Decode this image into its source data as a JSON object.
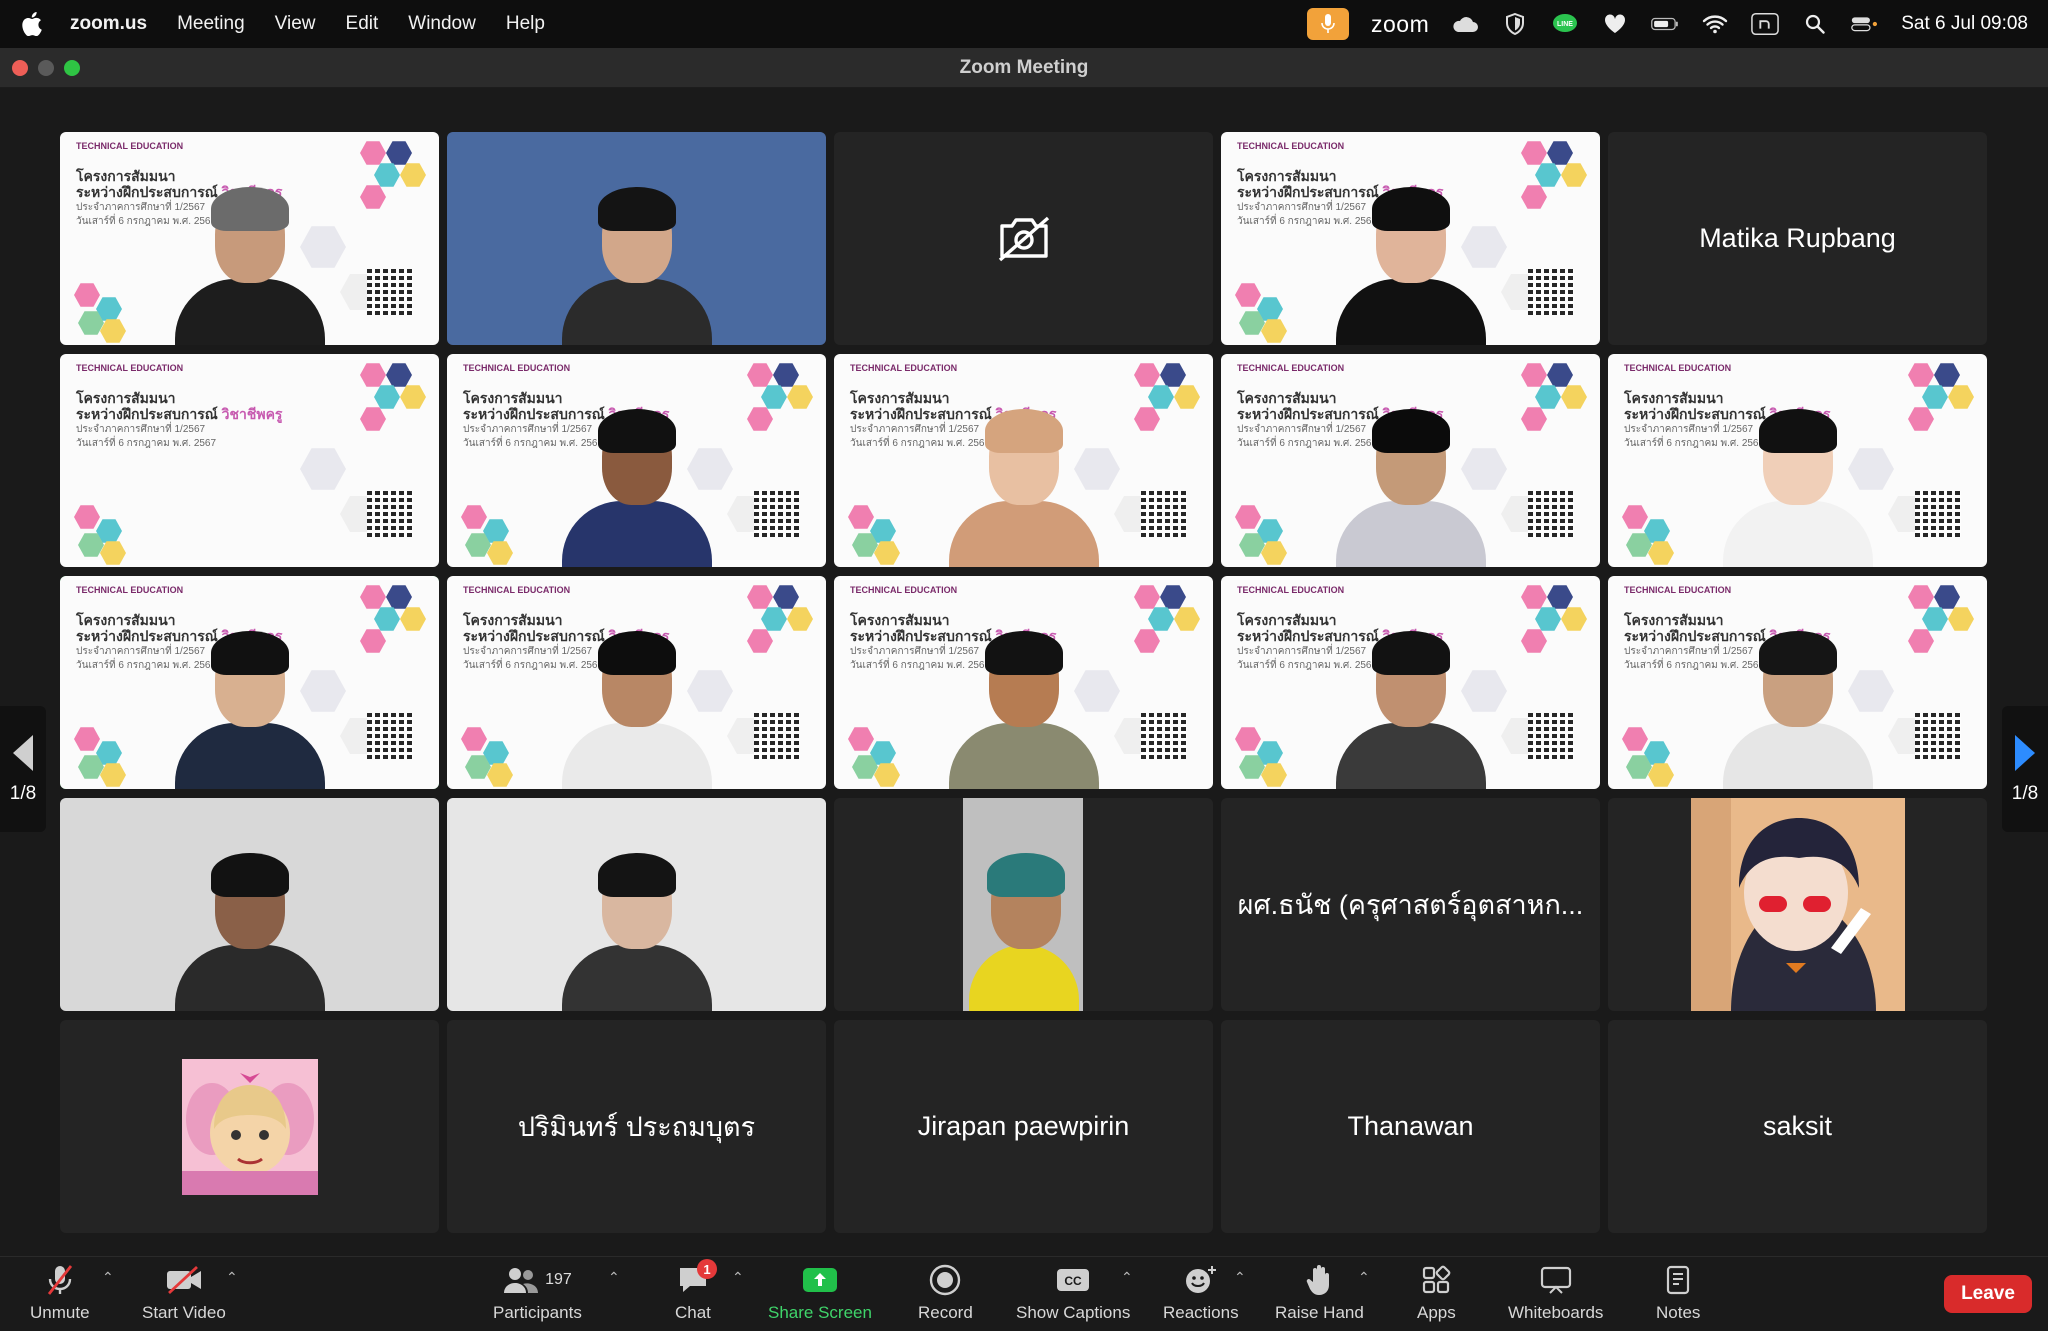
{
  "menubar": {
    "app": "zoom.us",
    "menus": [
      "Meeting",
      "View",
      "Edit",
      "Window",
      "Help"
    ],
    "brand": "zoom",
    "datetime": "Sat 6 Jul  09:08"
  },
  "window": {
    "title": "Zoom Meeting"
  },
  "slide": {
    "logo": "TECHNICAL EDUCATION",
    "line1": "โครงการสัมมนา",
    "line2": "ระหว่างฝึกประสบการณ์",
    "highlight": "วิชาชีพครู",
    "line3": "ประจำภาคการศึกษาที่ 1/2567",
    "line4": "วันเสาร์ที่ 6 กรกฎาคม พ.ศ. 2567"
  },
  "tiles": [
    {
      "type": "slide",
      "skin": "#c79a7b",
      "hair": "#6b6b6b",
      "shirt": "#1d1d1d"
    },
    {
      "type": "camera",
      "bg": "#4a6aa0",
      "skin": "#d2a78a",
      "hair": "#141414",
      "shirt": "#2b2b2b"
    },
    {
      "type": "video-off"
    },
    {
      "type": "slide",
      "skin": "#e0b49a",
      "hair": "#0f0f0f",
      "shirt": "#111"
    },
    {
      "type": "name",
      "name": "Matika Rupbang"
    },
    {
      "type": "slide-empty"
    },
    {
      "type": "slide",
      "skin": "#8a5a3e",
      "hair": "#111",
      "shirt": "#27356b"
    },
    {
      "type": "slide",
      "skin": "#e8c0a2",
      "hair": "#d5a47e",
      "shirt": "#d19c78"
    },
    {
      "type": "slide",
      "skin": "#c49a78",
      "hair": "#0b0b0b",
      "shirt": "#c9c9d2"
    },
    {
      "type": "slide",
      "skin": "#f0cfb8",
      "hair": "#111",
      "shirt": "#f2f2f2"
    },
    {
      "type": "slide",
      "skin": "#d8b090",
      "hair": "#111",
      "shirt": "#1f2a40",
      "active": true
    },
    {
      "type": "slide",
      "skin": "#b88765",
      "hair": "#0d0d0d",
      "shirt": "#eaeaea"
    },
    {
      "type": "slide",
      "skin": "#b67c52",
      "hair": "#121212",
      "shirt": "#8a8a70"
    },
    {
      "type": "slide",
      "skin": "#c09070",
      "hair": "#121212",
      "shirt": "#3a3a3a"
    },
    {
      "type": "slide",
      "skin": "#c9a080",
      "hair": "#151515",
      "shirt": "#e6e6e6"
    },
    {
      "type": "camera",
      "bg": "#d8d8d8",
      "skin": "#8a6048",
      "hair": "#121212",
      "shirt": "#2a2a2a"
    },
    {
      "type": "camera",
      "bg": "#e6e6e6",
      "skin": "#d9b7a0",
      "hair": "#141414",
      "shirt": "#333"
    },
    {
      "type": "camera-narrow",
      "bg": "#bfbfbf",
      "skin": "#b4835e",
      "hair": "#2a7a7a",
      "shirt": "#e8d520"
    },
    {
      "type": "name",
      "name": "ผศ.ธนัช (ครุศาสตร์อุตสาหก..."
    },
    {
      "type": "anime"
    },
    {
      "type": "avatar-pink"
    },
    {
      "type": "name",
      "name": "ปริมินทร์ ประถมบุตร"
    },
    {
      "type": "name",
      "name": "Jirapan paewpirin"
    },
    {
      "type": "name",
      "name": "Thanawan"
    },
    {
      "type": "name",
      "name": "saksit"
    }
  ],
  "pager": {
    "left": "1/8",
    "right": "1/8"
  },
  "toolbar": {
    "unmute": "Unmute",
    "start_video": "Start Video",
    "participants": "Participants",
    "participant_count": "197",
    "chat": "Chat",
    "chat_badge": "1",
    "share": "Share Screen",
    "record": "Record",
    "captions": "Show Captions",
    "reactions": "Reactions",
    "raise_hand": "Raise Hand",
    "apps": "Apps",
    "whiteboards": "Whiteboards",
    "notes": "Notes",
    "leave": "Leave"
  },
  "colors": {
    "accent_green": "#21c04a",
    "leave_red": "#d92b2b",
    "share_green": "#3fd46a"
  }
}
